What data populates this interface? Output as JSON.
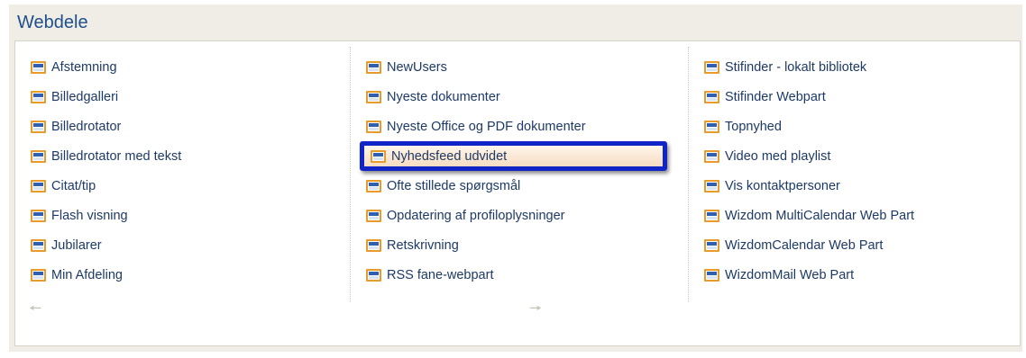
{
  "panel": {
    "title": "Webdele",
    "columns": [
      {
        "items": [
          {
            "label": "Afstemning"
          },
          {
            "label": "Billedgalleri"
          },
          {
            "label": "Billedrotator"
          },
          {
            "label": "Billedrotator med tekst"
          },
          {
            "label": "Citat/tip"
          },
          {
            "label": "Flash visning"
          },
          {
            "label": "Jubilarer"
          },
          {
            "label": "Min Afdeling"
          }
        ]
      },
      {
        "items": [
          {
            "label": "NewUsers"
          },
          {
            "label": "Nyeste dokumenter"
          },
          {
            "label": "Nyeste Office og PDF dokumenter"
          },
          {
            "label": "Nyhedsfeed udvidet",
            "selected": true
          },
          {
            "label": "Ofte stillede spørgsmål"
          },
          {
            "label": "Opdatering af profiloplysninger"
          },
          {
            "label": "Retskrivning"
          },
          {
            "label": "RSS fane-webpart"
          }
        ]
      },
      {
        "items": [
          {
            "label": "Stifinder - lokalt bibliotek"
          },
          {
            "label": "Stifinder Webpart"
          },
          {
            "label": "Topnyhed"
          },
          {
            "label": "Video med playlist"
          },
          {
            "label": "Vis kontaktpersoner"
          },
          {
            "label": "Wizdom MultiCalendar Web Part"
          },
          {
            "label": "WizdomCalendar Web Part"
          },
          {
            "label": "WizdomMail Web Part"
          }
        ]
      }
    ],
    "item_icon": "webpart-icon",
    "nav": {
      "prev_icon": "arrow-left-icon",
      "next_icon": "arrow-right-icon"
    }
  },
  "colors": {
    "title": "#1f4f8c",
    "icon_border": "#e89a2a",
    "selection_border": "#1024c8"
  }
}
